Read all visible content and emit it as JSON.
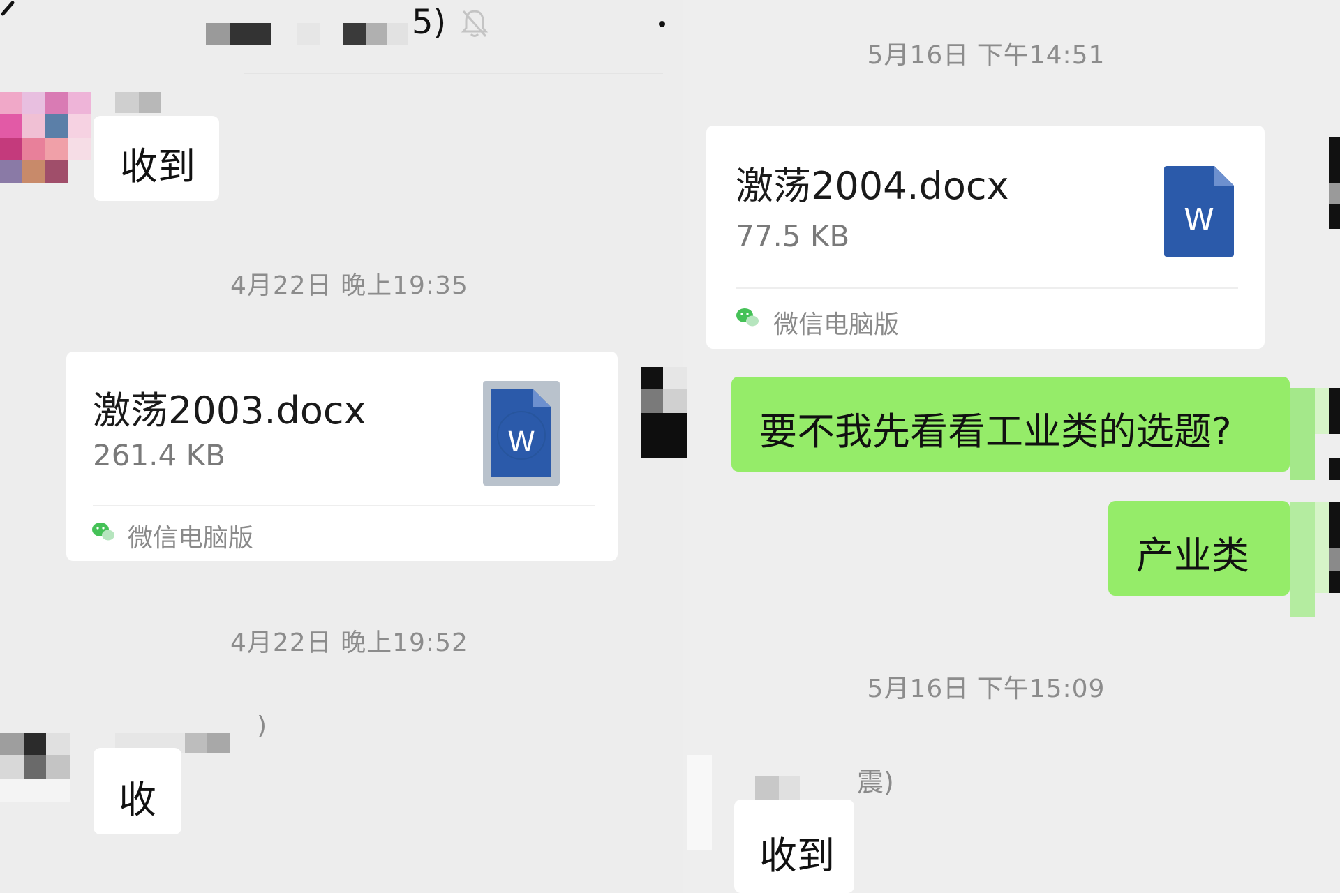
{
  "left_panel": {
    "header_suffix": "5)",
    "icons": {
      "back": "back-chevron-icon",
      "mute": "bell-mute-icon"
    },
    "messages": [
      {
        "type": "text",
        "text": "收到"
      },
      {
        "type": "timestamp",
        "text": "4月22日 晚上19:35"
      },
      {
        "type": "file",
        "name": "激荡2003.docx",
        "size": "261.4 KB",
        "source": "微信电脑版",
        "icon": "word-file-icon"
      },
      {
        "type": "timestamp",
        "text": "4月22日 晚上19:52"
      },
      {
        "type": "sender_fragment",
        "text": ")"
      },
      {
        "type": "text",
        "text": "收"
      }
    ]
  },
  "right_panel": {
    "messages": [
      {
        "type": "timestamp",
        "text": "5月16日 下午14:51"
      },
      {
        "type": "file",
        "name": "激荡2004.docx",
        "size": "77.5 KB",
        "source": "微信电脑版",
        "icon": "word-file-icon"
      },
      {
        "type": "text",
        "text": "要不我先看看工业类的选题?"
      },
      {
        "type": "text",
        "text": "产业类"
      },
      {
        "type": "timestamp",
        "text": "5月16日 下午15:09"
      },
      {
        "type": "sender_fragment",
        "text": "震)"
      },
      {
        "type": "text",
        "text": "收到"
      }
    ]
  },
  "colors": {
    "background": "#ededed",
    "bubble_white": "#ffffff",
    "bubble_green": "#95ec69",
    "word_blue": "#2b5aaa",
    "timestamp_gray": "#8c8c8c"
  }
}
